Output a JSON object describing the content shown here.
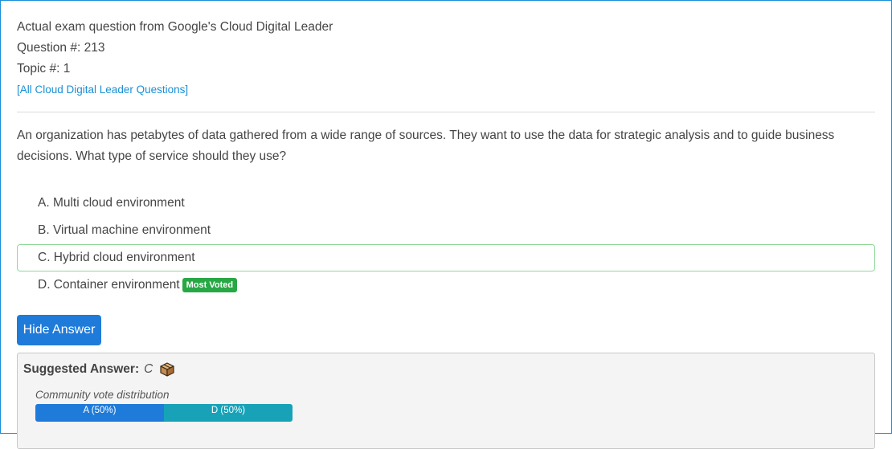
{
  "header": {
    "source_line": "Actual exam question from Google's Cloud Digital Leader",
    "question_number": "Question #: 213",
    "topic_number": "Topic #: 1",
    "all_questions_link": "[All Cloud Digital Leader Questions]"
  },
  "question": {
    "text": "An organization has petabytes of data gathered from a wide range of sources. They want to use the data for strategic analysis and to guide business decisions. What type of service should they use?"
  },
  "choices": [
    {
      "label": "A. Multi cloud environment"
    },
    {
      "label": "B. Virtual machine environment"
    },
    {
      "label": "C. Hybrid cloud environment"
    },
    {
      "label": "D. Container environment",
      "badge": "Most Voted"
    }
  ],
  "actions": {
    "hide_answer": "Hide Answer"
  },
  "answer": {
    "suggested_label": "Suggested Answer:",
    "suggested_value": "C",
    "vote_title": "Community vote distribution",
    "votes": [
      {
        "label": "A (50%)",
        "percent": 50,
        "color": "#1f7bd9"
      },
      {
        "label": "D (50%)",
        "percent": 50,
        "color": "#17a2b8"
      }
    ]
  },
  "colors": {
    "link": "#1a8fd6",
    "correct_border": "#8fd99a",
    "badge": "#28a745",
    "button": "#1f7bd9"
  },
  "icons": {
    "reveal": "box-icon"
  }
}
